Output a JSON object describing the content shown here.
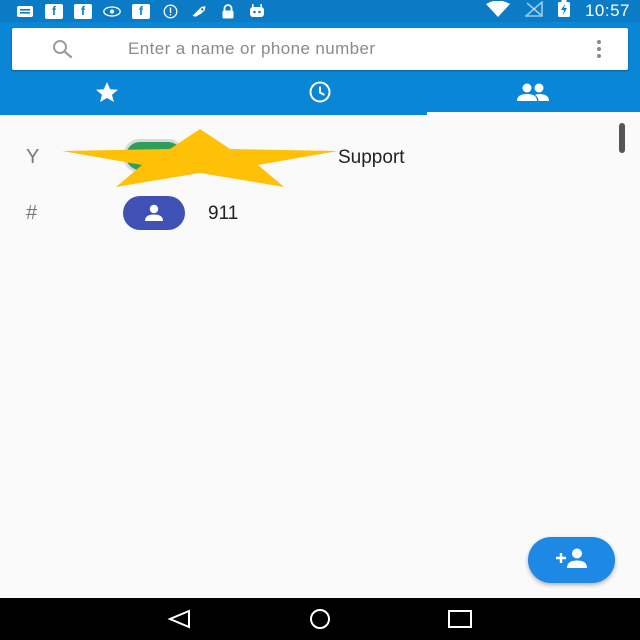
{
  "status_bar": {
    "icons_left": [
      "notification-icon",
      "facebook-icon",
      "facebook-icon",
      "eye-icon",
      "facebook-icon",
      "info-icon",
      "rocket-icon",
      "lock-icon",
      "android-icon"
    ],
    "fb_glyph": "f",
    "icons_right": [
      "wifi-icon",
      "no-signal-icon",
      "battery-charging-icon"
    ],
    "time": "10:57"
  },
  "search": {
    "placeholder": "Enter a name or phone number"
  },
  "tabs": [
    {
      "name": "tab-favorites",
      "icon": "star-icon",
      "active": false
    },
    {
      "name": "tab-recents",
      "icon": "clock-icon",
      "active": false
    },
    {
      "name": "tab-contacts",
      "icon": "people-icon",
      "active": true
    }
  ],
  "contacts": [
    {
      "section": "Y",
      "name": "Support"
    },
    {
      "section": "#",
      "name": "911"
    }
  ],
  "fab": {
    "icon": "add-contact-icon"
  },
  "nav": [
    "back-icon",
    "home-icon",
    "recents-icon"
  ],
  "colors": {
    "status_bar": "#0a7bc4",
    "header": "#0a86d6",
    "fab": "#1e88e5",
    "avatar": "#3f51b5",
    "sticker": "#ffc107"
  }
}
